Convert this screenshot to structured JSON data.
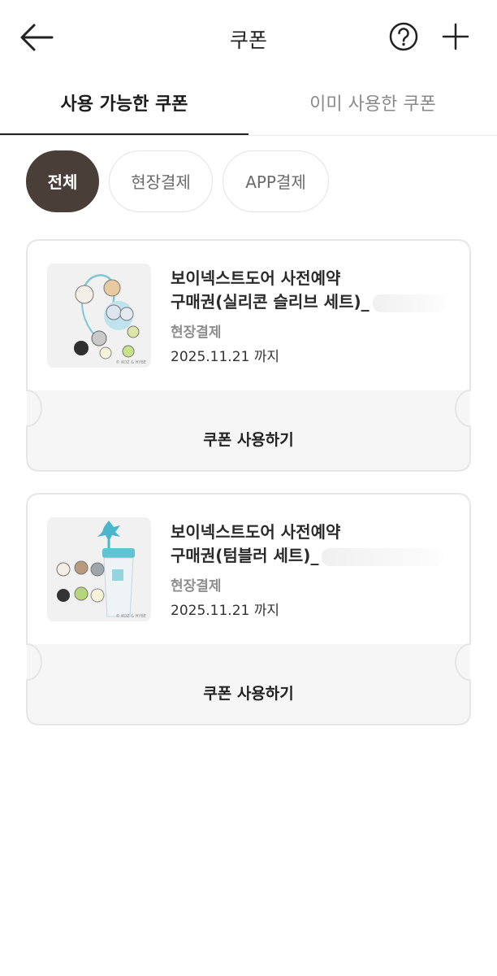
{
  "header": {
    "title": "쿠폰",
    "back_icon": "arrow-left-icon",
    "help_icon": "question-circle-icon",
    "add_icon": "plus-icon"
  },
  "tabs": [
    {
      "label": "사용 가능한 쿠폰",
      "active": true
    },
    {
      "label": "이미 사용한 쿠폰",
      "active": false
    }
  ],
  "filters": [
    {
      "label": "전체",
      "selected": true
    },
    {
      "label": "현장결제",
      "selected": false
    },
    {
      "label": "APP결제",
      "selected": false
    }
  ],
  "coupons": [
    {
      "name_line1": "보이넥스트도어 사전예약",
      "name_line2": "구매권(실리콘 슬리브 세트)_",
      "payment_type": "현장결제",
      "expiry": "2025.11.21 까지",
      "button_label": "쿠폰 사용하기",
      "copyright": "© KOZ & HYBE"
    },
    {
      "name_line1": "보이넥스트도어 사전예약",
      "name_line2": "구매권(텀블러 세트)_",
      "payment_type": "현장결제",
      "expiry": "2025.11.21 까지",
      "button_label": "쿠폰 사용하기",
      "copyright": "© KOZ & HYBE"
    }
  ],
  "colors": {
    "chip_selected_bg": "#4a3e38",
    "card_footer_bg": "#f6f6f6",
    "border": "#e6e6e6"
  }
}
